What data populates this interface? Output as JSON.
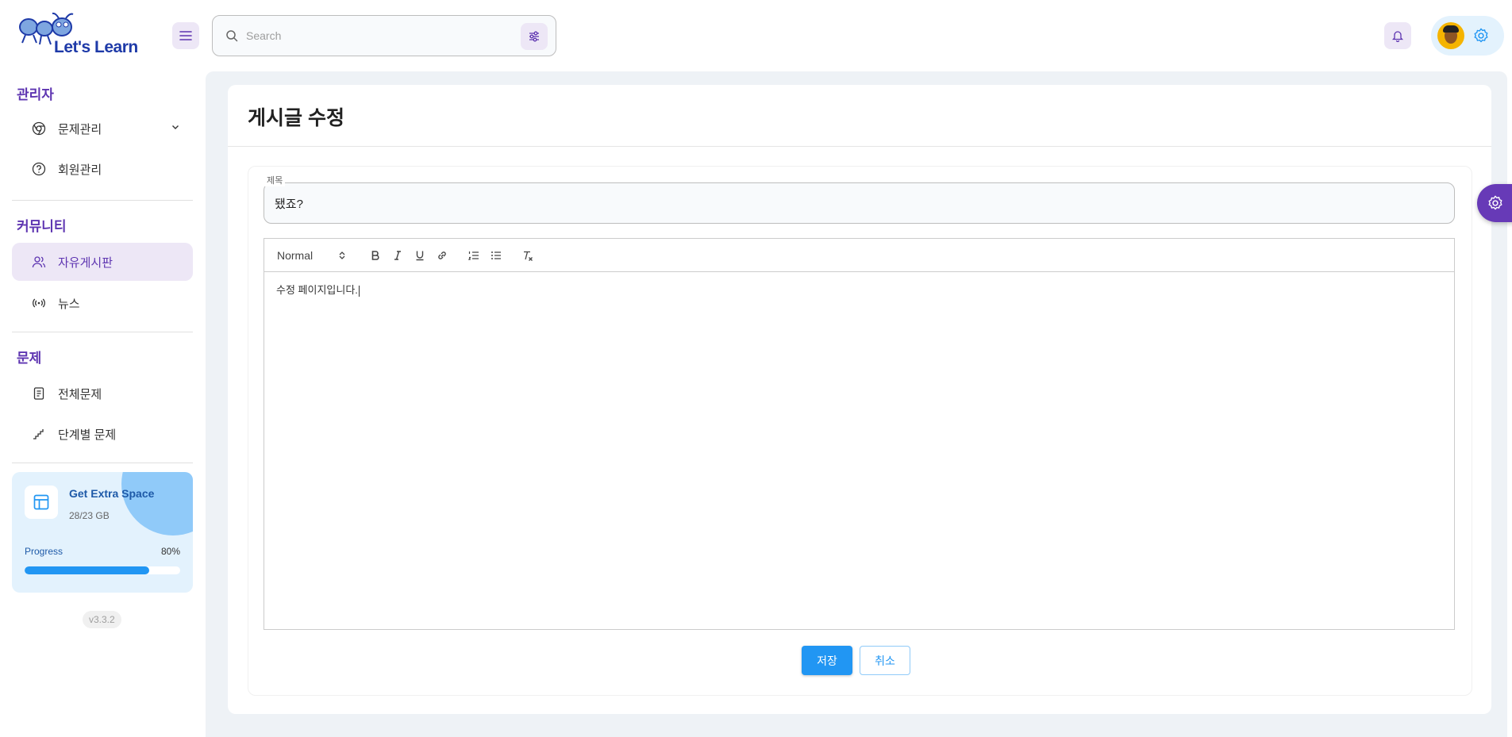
{
  "app": {
    "logo_text": "Let's Learn"
  },
  "search": {
    "placeholder": "Search"
  },
  "sidebar": {
    "sections": [
      {
        "title": "관리자",
        "items": [
          {
            "label": "문제관리",
            "icon": "chrome-icon"
          },
          {
            "label": "회원관리",
            "icon": "help-circle-icon"
          }
        ]
      },
      {
        "title": "커뮤니티",
        "items": [
          {
            "label": "자유게시판",
            "icon": "users-icon"
          },
          {
            "label": "뉴스",
            "icon": "broadcast-icon"
          }
        ]
      },
      {
        "title": "문제",
        "items": [
          {
            "label": "전체문제",
            "icon": "document-icon"
          },
          {
            "label": "단계별 문제",
            "icon": "stairs-icon"
          }
        ]
      }
    ],
    "active_item": "자유게시판"
  },
  "storage_card": {
    "title": "Get Extra Space",
    "usage": "28/23 GB",
    "progress_label": "Progress",
    "progress_text": "80%",
    "progress": 0.8
  },
  "version": "v3.3.2",
  "page": {
    "title": "게시글 수정",
    "field_label": "제목",
    "title_value": "됐죠?",
    "editor": {
      "format": "Normal",
      "content": "수정 페이지입니다."
    },
    "save_label": "저장",
    "cancel_label": "취소"
  },
  "colors": {
    "accent": "#5e35b1",
    "primary": "#2196f3",
    "accent_light": "#ede7f6"
  }
}
